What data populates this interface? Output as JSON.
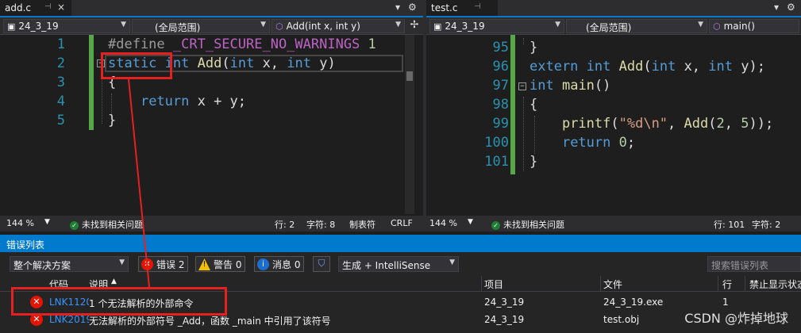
{
  "left": {
    "tab_title": "add.c",
    "tab_pin": "⊣",
    "tab_close": "×",
    "tab_menu": "▾",
    "tab_settings": "⚙",
    "nav_project": "24_3_19",
    "nav_scope": "(全局范围)",
    "nav_member": "Add(int x, int y)",
    "split_glyph": "✢",
    "zoom": "144 %",
    "status_issues": "未找到相关问题",
    "status_line": "行: 2",
    "status_char": "字符: 8",
    "status_tab": "制表符",
    "status_eol": "CRLF",
    "lines": [
      {
        "n": "1",
        "tokens": [
          {
            "c": "pp",
            "t": "#define "
          },
          {
            "c": "mac",
            "t": "_CRT_SECURE_NO_WARNINGS"
          },
          {
            "c": "",
            "t": " "
          },
          {
            "c": "num",
            "t": "1"
          }
        ]
      },
      {
        "n": "2",
        "tokens": [
          {
            "c": "kw",
            "t": "static"
          },
          {
            "c": "",
            "t": " "
          },
          {
            "c": "kw",
            "t": "int"
          },
          {
            "c": "",
            "t": " "
          },
          {
            "c": "fn",
            "t": "Add"
          },
          {
            "c": "",
            "t": "("
          },
          {
            "c": "kw",
            "t": "int"
          },
          {
            "c": "",
            "t": " x, "
          },
          {
            "c": "kw",
            "t": "int"
          },
          {
            "c": "",
            "t": " y)"
          }
        ]
      },
      {
        "n": "3",
        "tokens": [
          {
            "c": "",
            "t": "{"
          }
        ]
      },
      {
        "n": "4",
        "tokens": [
          {
            "c": "",
            "t": "    "
          },
          {
            "c": "kw",
            "t": "return"
          },
          {
            "c": "",
            "t": " x + y;"
          }
        ]
      },
      {
        "n": "5",
        "tokens": [
          {
            "c": "",
            "t": "}"
          }
        ]
      }
    ]
  },
  "right": {
    "tab_title": "test.c",
    "tab_pin": "⊣",
    "tab_menu": "▾",
    "tab_settings": "⚙",
    "nav_project": "24_3_19",
    "nav_scope": "(全局范围)",
    "nav_member": "main()",
    "zoom": "144 %",
    "status_issues": "未找到相关问题",
    "status_line": "行: 101",
    "status_char": "字符: 2",
    "lines": [
      {
        "n": "95",
        "tokens": [
          {
            "c": "",
            "t": "}"
          }
        ]
      },
      {
        "n": "96",
        "tokens": [
          {
            "c": "kw",
            "t": "extern"
          },
          {
            "c": "",
            "t": " "
          },
          {
            "c": "kw",
            "t": "int"
          },
          {
            "c": "",
            "t": " "
          },
          {
            "c": "fn",
            "t": "Add"
          },
          {
            "c": "",
            "t": "("
          },
          {
            "c": "kw",
            "t": "int"
          },
          {
            "c": "",
            "t": " x, "
          },
          {
            "c": "kw",
            "t": "int"
          },
          {
            "c": "",
            "t": " y);"
          }
        ]
      },
      {
        "n": "97",
        "tokens": [
          {
            "c": "kw",
            "t": "int"
          },
          {
            "c": "",
            "t": " "
          },
          {
            "c": "fn",
            "t": "main"
          },
          {
            "c": "",
            "t": "()"
          }
        ]
      },
      {
        "n": "98",
        "tokens": [
          {
            "c": "",
            "t": "{"
          }
        ]
      },
      {
        "n": "99",
        "tokens": [
          {
            "c": "",
            "t": "    "
          },
          {
            "c": "fn",
            "t": "printf"
          },
          {
            "c": "",
            "t": "("
          },
          {
            "c": "str",
            "t": "\"%d\\n\""
          },
          {
            "c": "",
            "t": ", "
          },
          {
            "c": "fn",
            "t": "Add"
          },
          {
            "c": "",
            "t": "("
          },
          {
            "c": "num",
            "t": "2"
          },
          {
            "c": "",
            "t": ", "
          },
          {
            "c": "num",
            "t": "5"
          },
          {
            "c": "",
            "t": "));"
          }
        ]
      },
      {
        "n": "100",
        "tokens": [
          {
            "c": "",
            "t": "    "
          },
          {
            "c": "kw",
            "t": "return"
          },
          {
            "c": "",
            "t": " "
          },
          {
            "c": "num",
            "t": "0"
          },
          {
            "c": "",
            "t": ";"
          }
        ]
      },
      {
        "n": "101",
        "tokens": [
          {
            "c": "",
            "t": "}"
          }
        ]
      }
    ]
  },
  "errors": {
    "panel_title": "错误列表",
    "scope_dropdown": "整个解决方案",
    "errors_btn": "错误 2",
    "warnings_btn": "警告 0",
    "messages_btn": "消息 0",
    "build_dropdown": "生成 + IntelliSense",
    "search_placeholder": "搜索错误列表",
    "headers": {
      "code": "代码",
      "desc": "说明",
      "project": "项目",
      "file": "文件",
      "line": "行",
      "suppress": "禁止显示状态"
    },
    "rows": [
      {
        "code": "LNK1120",
        "desc": "1 个无法解析的外部命令",
        "project": "24_3_19",
        "file": "24_3_19.exe",
        "line": "1"
      },
      {
        "code": "LNK2019",
        "desc": "无法解析的外部符号 _Add，函数 _main 中引用了该符号",
        "project": "24_3_19",
        "file": "test.obj",
        "line": ""
      }
    ]
  },
  "watermark": "CSDN @炸掉地球",
  "colors": {
    "accent": "#007acc",
    "annotation": "#e52020",
    "error": "#e51400"
  }
}
